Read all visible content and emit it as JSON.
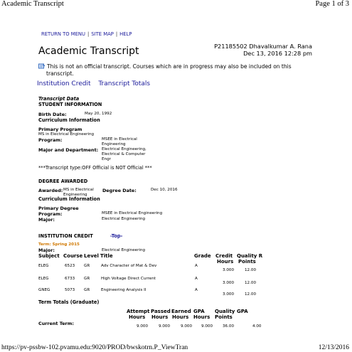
{
  "browser": {
    "page_title": "Academic Transcript",
    "page_counter": "Page 1 of 3",
    "url": "https://pv-pssbw-102.pvamu.edu:9020/PROD/bwskotrn.P_ViewTran",
    "print_date": "12/13/2016"
  },
  "nav": {
    "return": "RETURN TO MENU",
    "sitemap": "SITE MAP",
    "help": "HELP",
    "sep": "|"
  },
  "header": {
    "title": "Academic Transcript",
    "student_id_name": "P21185502 Dhavalkumar A. Rana",
    "date": "Dec 13, 2016 12:28 pm"
  },
  "notice": {
    "line1": "This is not an official transcript. Courses which are in progress may also be included on this",
    "line2": "transcript."
  },
  "tabs": {
    "institution_credit": "Institution Credit",
    "transcript_totals": "Transcript Totals"
  },
  "transcript_data": {
    "heading": "Transcript Data",
    "student_info": "STUDENT INFORMATION",
    "birth_label": "Birth Date:",
    "birth_value": "May 20, 1992",
    "curriculum": "Curriculum Information",
    "primary_program": "Primary Program",
    "program_desc": "MS in Electrical Engineering",
    "program_label": "Program:",
    "program_value_1": "MSEE in Electrical",
    "program_value_2": "Engineering",
    "major_label": "Major and Department:",
    "major_value_1": "Electrical Engineering,",
    "major_value_2": "Electrical & Computer",
    "major_value_3": "Engr",
    "type_line": "***Transcript type:OFF Official is NOT Official ***"
  },
  "degree": {
    "heading": "DEGREE AWARDED",
    "awarded_label": "Awarded:",
    "awarded_value_1": "MS in Electrical",
    "awarded_value_2": "Engineering",
    "date_label": "Degree Date:",
    "date_value": "Dec 10, 2016",
    "curriculum": "Curriculum Information",
    "primary_degree": "Primary Degree",
    "program_label": "Program:",
    "program_value": "MSEE in Electrical Engineering",
    "major_label": "Major:",
    "major_value": "Electrical Engineering"
  },
  "institution": {
    "heading": "INSTITUTION CREDIT",
    "top_link": "-Top-",
    "term": "Term: Spring 2015",
    "major_label": "Major:",
    "major_value": "Electrical Engineering",
    "col_subject": "Subject",
    "col_course": "Course",
    "col_level": "Level",
    "col_title": "Title",
    "col_grade": "Grade",
    "col_credit_1": "Credit",
    "col_credit_2": "Hours",
    "col_quality_1": "Quality R",
    "col_quality_2": "Points",
    "rows": [
      {
        "subject": "ELEG",
        "course": "6523",
        "level": "GR",
        "title": "Adv Character of Mat & Dev",
        "grade": "A",
        "hours": "3.000",
        "points": "12.00"
      },
      {
        "subject": "ELEG",
        "course": "6733",
        "level": "GR",
        "title": "High Voltage Direct Current",
        "grade": "A",
        "hours": "3.000",
        "points": "12.00"
      },
      {
        "subject": "GNEG",
        "course": "5073",
        "level": "GR",
        "title": "Engineering Analysis II",
        "grade": "A",
        "hours": "3.000",
        "points": "12.00"
      }
    ]
  },
  "totals": {
    "heading": "Term Totals (Graduate)",
    "h_attempt_1": "Attempt",
    "h_attempt_2": "Hours",
    "h_passed_1": "Passed",
    "h_passed_2": "Hours",
    "h_earned_1": "Earned",
    "h_earned_2": "Hours",
    "h_gpa_1": "GPA",
    "h_gpa_2": "Hours",
    "h_qp_1": "Quality",
    "h_qp_2": "Points",
    "h_gpa": "GPA",
    "row_label": "Current Term:",
    "attempt": "9.000",
    "passed": "9.000",
    "earned": "9.000",
    "gpa_hours": "9.000",
    "quality": "36.00",
    "gpa": "4.00"
  }
}
